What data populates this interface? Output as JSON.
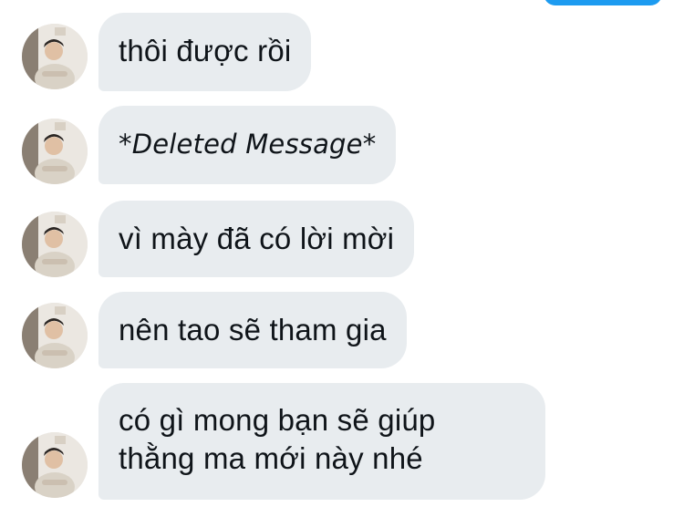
{
  "messages": [
    {
      "text": "thôi được rồi"
    },
    {
      "text": "*Deleted Message*"
    },
    {
      "text": "vì mày đã có lời mời"
    },
    {
      "text": "nên tao sẽ tham gia"
    },
    {
      "lines": [
        "có gì mong bạn sẽ giúp",
        "thằng ma mới này nhé"
      ]
    }
  ],
  "colors": {
    "incoming_bubble": "#e8ecef",
    "outgoing_bubble": "#1d9bf0",
    "text": "#0f1419"
  }
}
